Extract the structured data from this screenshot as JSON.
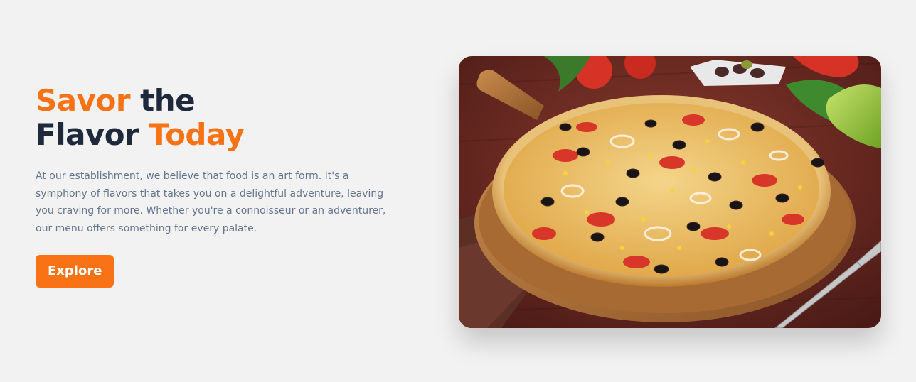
{
  "hero": {
    "title": {
      "part1": "Savor",
      "part2": " the",
      "part3": "Flavor ",
      "part4": "Today"
    },
    "description": "At our establishment, we believe that food is an art form. It's a symphony of flavors that takes you on a delightful adventure, leaving you craving for more. Whether you're a connoisseur or an adventurer, our menu offers something for every palate.",
    "explore_label": "Explore",
    "image": {
      "subject": "pizza-photo"
    }
  },
  "colors": {
    "accent": "#f97316",
    "heading": "#1e293b",
    "text": "#64748b",
    "background": "#f2f2f2"
  }
}
